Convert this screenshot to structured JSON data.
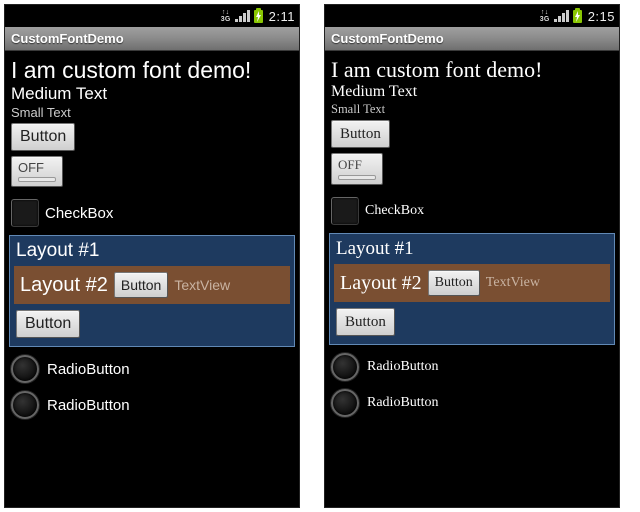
{
  "phones": [
    {
      "font": "sans",
      "status_time": "2:11"
    },
    {
      "font": "serif",
      "status_time": "2:15"
    }
  ],
  "status": {
    "network": "3G",
    "arrows": "↑↓"
  },
  "app": {
    "title": "CustomFontDemo"
  },
  "text": {
    "headline": "I am custom font demo!",
    "medium": "Medium Text",
    "small": "Small Text"
  },
  "buttons": {
    "generic": "Button",
    "toggle_state": "OFF",
    "checkbox_label": "CheckBox",
    "radio_label": "RadioButton"
  },
  "layouts": {
    "l1_title": "Layout #1",
    "l2_title": "Layout #2",
    "textview": "TextView"
  }
}
